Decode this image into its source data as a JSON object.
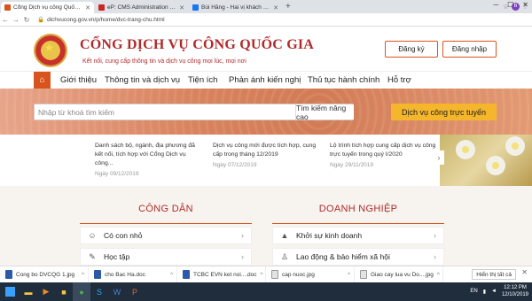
{
  "browser": {
    "tabs": [
      {
        "title": "Cổng Dịch vụ công Quốc gia",
        "favicon_color": "#d9531e",
        "active": true
      },
      {
        "title": "eP: CMS Administration : Tạo tin",
        "favicon_color": "#c62828",
        "active": false
      },
      {
        "title": "Bùi Hằng - Hai vị khách mời đến",
        "favicon_color": "#1877f2",
        "active": false
      }
    ],
    "new_tab": "+",
    "url": "dichvucong.gov.vn/p/home/dvc-trang-chu.html",
    "profile_initial": "B"
  },
  "site": {
    "title": "CỔNG DỊCH VỤ CÔNG QUỐC GIA",
    "subtitle": "Kết nối, cung cấp thông tin và dịch vụ công mọi lúc, mọi nơi",
    "register": "Đăng ký",
    "login": "Đăng nhập"
  },
  "nav": {
    "items": [
      "Giới thiệu",
      "Thông tin và dịch vụ",
      "Tiện ích",
      "Phản ánh kiến nghị",
      "Thủ tục hành chính",
      "Hỗ trợ"
    ]
  },
  "search": {
    "placeholder": "Nhập từ khoá tìm kiếm",
    "advanced": "Tìm kiếm nâng cao",
    "online_service": "Dịch vụ công trực tuyến"
  },
  "news": [
    {
      "title": "Danh sách bộ, ngành, địa phương đã kết nối, tích hợp với Cổng Dịch vụ công...",
      "date": "Ngày 09/12/2019"
    },
    {
      "title": "Dịch vụ công mới được tích hợp, cung cấp trong tháng 12/2019",
      "date": "Ngày 07/12/2019"
    },
    {
      "title": "Lộ trình tích hợp cung cấp dịch vụ công trực tuyến trong quý I/2020",
      "date": "Ngày 29/11/2019"
    }
  ],
  "sections": {
    "citizen": {
      "title": "CÔNG DÂN",
      "items": [
        {
          "label": "Có con nhỏ",
          "icon": "family-icon"
        },
        {
          "label": "Học tập",
          "icon": "study-icon"
        }
      ]
    },
    "business": {
      "title": "DOANH NGHIỆP",
      "items": [
        {
          "label": "Khởi sự kinh doanh",
          "icon": "chart-icon"
        },
        {
          "label": "Lao động & bảo hiểm xã hội",
          "icon": "worker-icon"
        }
      ]
    }
  },
  "downloads": [
    {
      "name": "Cong bo DVCQG 1.jpg",
      "type": "word"
    },
    {
      "name": "cho Bac Ha.doc",
      "type": "word"
    },
    {
      "name": "TCBC EVN ket noi....doc",
      "type": "word"
    },
    {
      "name": "cap nuoc.jpg",
      "type": "image"
    },
    {
      "name": "Giao cay lua vu Do....jpg",
      "type": "image"
    }
  ],
  "show_all": "Hiển thị tất cả",
  "taskbar": {
    "language": "EN",
    "time": "12:12 PM",
    "date": "12/10/2019"
  },
  "colors": {
    "accent": "#d9531e",
    "brand_red": "#b22a2a",
    "cta_yellow": "#f5b62b"
  }
}
